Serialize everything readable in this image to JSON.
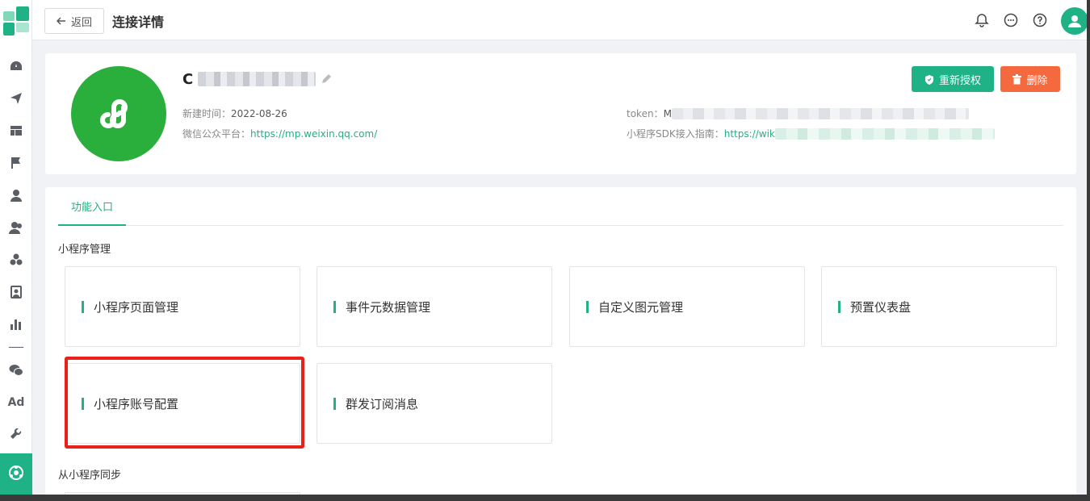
{
  "header": {
    "back_label": "返回",
    "title": "连接详情"
  },
  "app": {
    "name_prefix": "C",
    "created_label": "新建时间：",
    "created_value": "2022-08-26",
    "platform_label": "微信公众平台：",
    "platform_url": "https://mp.weixin.qq.com/",
    "token_label": "token：",
    "token_value_prefix": "M",
    "sdk_label": "小程序SDK接入指南：",
    "sdk_url_prefix": "https://wik"
  },
  "actions": {
    "reauth_label": "重新授权",
    "delete_label": "删除"
  },
  "tabs": [
    {
      "label": "功能入口",
      "active": true
    }
  ],
  "sections": {
    "manage_title": "小程序管理",
    "sync_title": "从小程序同步"
  },
  "feature_cards": [
    {
      "label": "小程序页面管理"
    },
    {
      "label": "事件元数据管理"
    },
    {
      "label": "自定义图元管理"
    },
    {
      "label": "预置仪表盘"
    },
    {
      "label": "小程序账号配置",
      "highlighted": true
    },
    {
      "label": "群发订阅消息"
    }
  ],
  "sidebar": {
    "icons": [
      "dashboard-icon",
      "send-icon",
      "layout-icon",
      "flag-icon",
      "user-icon",
      "users-icon",
      "cluster-icon",
      "profile-icon",
      "bar-chart-icon",
      "wechat-icon",
      "ad-icon",
      "wrench-icon",
      "miniprogram-icon"
    ],
    "ad_text": "Ad"
  },
  "colors": {
    "accent": "#1fb286",
    "danger": "#f5693f",
    "highlight_border": "#e8221a",
    "app_logo_bg": "#2aae3c"
  }
}
